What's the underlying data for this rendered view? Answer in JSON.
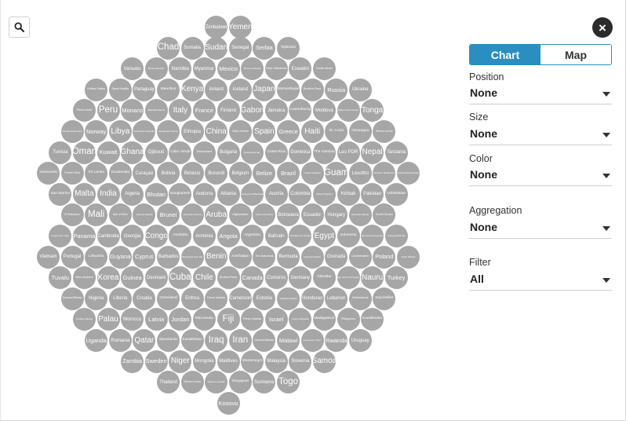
{
  "toolbar": {
    "search_icon": "search-icon",
    "close_icon": "close-icon",
    "close_glyph": "×"
  },
  "view_toggle": {
    "options": [
      "Chart",
      "Map"
    ],
    "selected": "Chart",
    "accent_color": "#2a8ec0"
  },
  "controls": [
    {
      "label": "Position",
      "value": "None"
    },
    {
      "label": "Size",
      "value": "None"
    },
    {
      "label": "Color",
      "value": "None"
    },
    {
      "label": "Aggregation",
      "value": "None"
    },
    {
      "label": "Filter",
      "value": "All"
    }
  ],
  "bubble_color": "#a6a6a6",
  "bubble_rows": [
    [
      "Zimbabwe",
      "Yemen"
    ],
    [
      "Chad",
      "Somalia",
      "Sudan",
      "Senegal",
      "Serbia",
      "Tajikistan"
    ],
    [
      "Vanuatu",
      "Benin Republic",
      "Namibia",
      "Myanmar",
      "Mexico",
      "Solomon Islands",
      "New Caledonia",
      "Eswatini",
      "South Africa"
    ],
    [
      "United States",
      "Saudi Arabia",
      "Paraguay",
      "Mauritius",
      "Kenya",
      "Ireland",
      "Iceland",
      "Japan",
      "Mozambique",
      "Burkina Faso",
      "Russia",
      "Ukraine"
    ],
    [
      "Timor-Leste",
      "Peru",
      "Monaco",
      "Marshall Islands",
      "Italy",
      "France",
      "Finland",
      "Gabon",
      "Jamaica",
      "Luxembourg",
      "Moldova",
      "Papua New Guinea",
      "Tonga"
    ],
    [
      "Central African Rep.",
      "Norway",
      "Libya",
      "Dominican Republic",
      "Equatorial Guinea",
      "Ethiopia",
      "China",
      "Côte d'Ivoire",
      "Spain",
      "Greece",
      "Haiti",
      "St. Lucia",
      "Nicaragua",
      "Sierra Leone"
    ],
    [
      "Tunisia",
      "Oman",
      "Kuwait",
      "Ghana",
      "Djibouti",
      "Cabo Verde",
      "Switzerland",
      "Bulgaria",
      "Bosnia-Herzeg.",
      "Costa Rica",
      "Dominica",
      "The Gambia",
      "Lao PDR",
      "Nepal",
      "Tanzania"
    ],
    [
      "Venezuela",
      "Puerto Rico",
      "Sri Lanka",
      "Guatemala",
      "Curaçao",
      "Bolivia",
      "Belarus",
      "Burundi",
      "Belgium",
      "Belize",
      "Brazil",
      "United Kingdom",
      "Guam",
      "Lesotho",
      "Northern Mariana Is.",
      "United Arab Emirates"
    ],
    [
      "San Marino",
      "Malta",
      "India",
      "Algeria",
      "Bhutan",
      "Bangladesh",
      "Andorra",
      "Albania",
      "Antigua and Barbuda",
      "Austria",
      "Colombia",
      "United Kingdom",
      "Kiribati",
      "Pakistan",
      "Uzbekistan"
    ],
    [
      "El Salvador",
      "Mali",
      "Isle of Man",
      "Cayman Islands",
      "Brunei",
      "American Samoa",
      "Aruba",
      "Afghanistan",
      "Turks and Caicos",
      "Botswana",
      "Ecuador",
      "Hungary",
      "Marshall Islands",
      "South Sudan"
    ],
    [
      "Congo Dem. Rep.",
      "Panama",
      "Cambodia",
      "Georgia",
      "Congo",
      "Australia",
      "Armenia",
      "Angola",
      "Argentina",
      "Bahrain",
      "Trinidad and Tobago",
      "Egypt",
      "Indonesia",
      "Bosnia Herzegovina",
      "Antigua Barbuda"
    ],
    [
      "Vietnam",
      "Portugal",
      "Lithuania",
      "Guyana",
      "Cyprus",
      "Barbados",
      "Micronesia Fed. Sts.",
      "Benin",
      "Azerbaijan",
      "The Bahamas",
      "Bermuda",
      "Cayman Islands",
      "Grenada",
      "Liechtenstein",
      "Poland",
      "Virgin Islands"
    ],
    [
      "Tuvalu",
      "New Zealand",
      "Korea",
      "Guinea",
      "Denmark",
      "Cuba",
      "Chile",
      "Burkina Faso",
      "Canada",
      "Comoros",
      "Germany",
      "Gibraltar",
      "Sao Tome & Principe",
      "Nauru",
      "Turkey"
    ],
    [
      "Guinea-Bissau",
      "Nigeria",
      "Liberia",
      "Croatia",
      "Greenland",
      "Eritrea",
      "Faroe Islands",
      "Cameroon",
      "Estonia",
      "Falkland Islands",
      "Honduras",
      "Lebanon",
      "Netherlands",
      "Seychelles"
    ],
    [
      "Trinidad Tobago",
      "Palau",
      "Morocco",
      "Latvia",
      "Jordan",
      "Micronesia",
      "Fiji",
      "Faroe Islands",
      "Israel",
      "Kyrgyz Republic",
      "Madagascar",
      "Philippines",
      "Kazakhstan"
    ],
    [
      "Uganda",
      "Romania",
      "Qatar",
      "Mauritania",
      "Kazakhstan",
      "Iraq",
      "Iran",
      "Guinea-Bissau",
      "Malawi",
      "Korea Dem. Rep.",
      "Rwanda",
      "Uruguay"
    ],
    [
      "Zambia",
      "Sweden",
      "Niger",
      "Mongolia",
      "Maldives",
      "Montenegro",
      "Malaysia",
      "Slovenia",
      "Samoa"
    ],
    [
      "Thailand",
      "Sierra Leone",
      "Solomon Islands",
      "Singapore",
      "Suriname",
      "Togo"
    ],
    [
      "Kosovo"
    ]
  ]
}
